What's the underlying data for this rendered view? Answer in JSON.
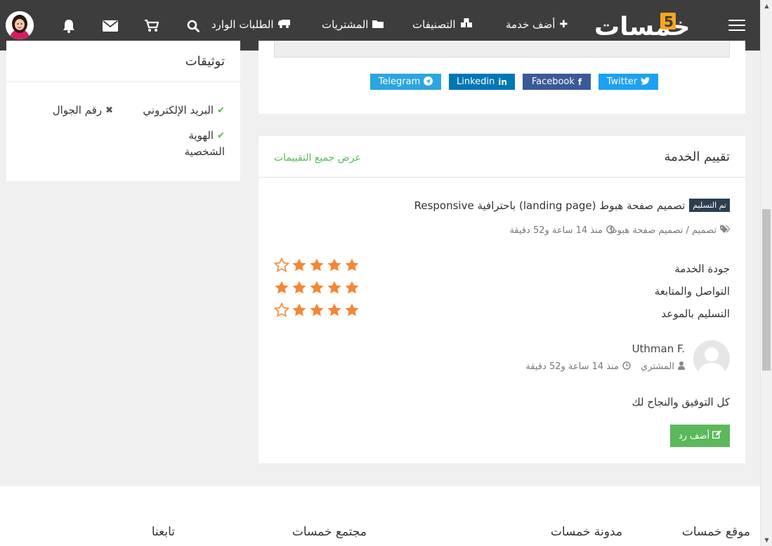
{
  "nav": {
    "logo_text": "خمسات",
    "add_service": "أضف خدمة",
    "categories": "التصنيفات",
    "purchases": "المشتريات",
    "incoming_orders": "الطلبات الوارد"
  },
  "verifications": {
    "title": "توثيقات",
    "email": "البريد الإلكتروني",
    "phone": "رقم الجوال",
    "identity_line1": "الهوية",
    "identity_line2": "الشخصية"
  },
  "share": {
    "twitter": "Twitter",
    "facebook": "Facebook",
    "linkedin": "Linkedin",
    "telegram": "Telegram"
  },
  "review": {
    "title": "تقييم الخدمة",
    "view_all": "عرض جميع التقييمات",
    "badge": "تم التسليم",
    "service_title": "تصميم صفحة هبوط (landing page) باحترافية Responsive",
    "category_path": "تصميم / تصميم صفحة هبوط",
    "time_ago": "منذ 14 ساعة و52 دقيقة",
    "ratings": [
      {
        "label": "جودة الخدمة",
        "stars": 4
      },
      {
        "label": "التواصل والمتابعة",
        "stars": 5
      },
      {
        "label": "التسليم بالموعد",
        "stars": 4
      }
    ],
    "reviewer_name": "Uthman F.",
    "reviewer_role": "المشتري",
    "reviewer_time": "منذ 14 ساعة و52 دقيقة",
    "comment": "كل التوفيق والنجاح لك",
    "reply_button": "أضف رد"
  },
  "footer": {
    "site": "موقع خمسات",
    "blog": "مدونة خمسات",
    "community": "مجتمع خمسات",
    "follow": "تابعنا"
  },
  "colors": {
    "navbar": "#3d3d3d",
    "logo_accent": "#f5a623",
    "green": "#5cb85c",
    "star": "#f58634",
    "twitter": "#1da1f2",
    "facebook": "#3b5998",
    "linkedin": "#0077b5",
    "telegram": "#2ca5e0"
  }
}
